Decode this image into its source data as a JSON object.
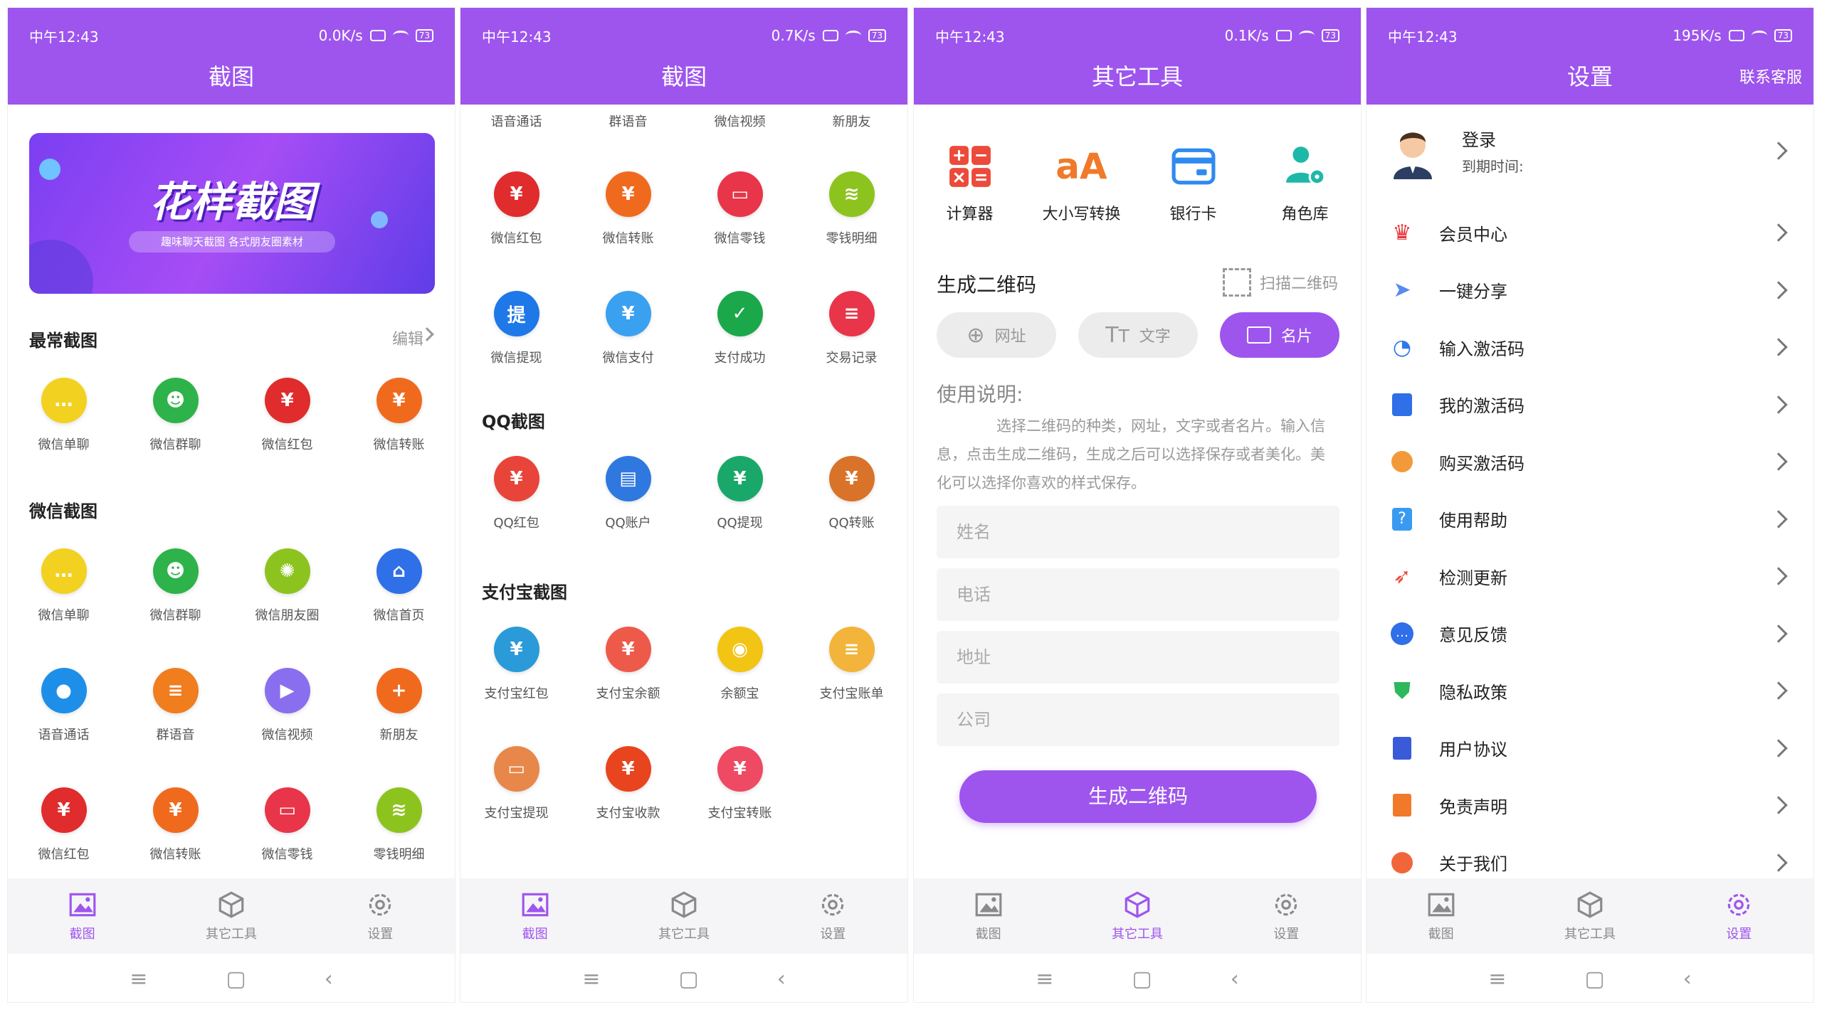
{
  "status": {
    "time": "中午12:43",
    "speeds": [
      "0.0K/s",
      "0.7K/s",
      "0.1K/s",
      "195K/s"
    ],
    "battery": "73"
  },
  "accent": "#9e55ee",
  "tabs": {
    "screenshot": "截图",
    "tools": "其它工具",
    "settings": "设置"
  },
  "panel1": {
    "title": "截图",
    "banner": {
      "title": "花样截图",
      "subtitle": "趣味聊天截图 各式朋友圈素材"
    },
    "frequent": {
      "title": "最常截图",
      "edit": "编辑",
      "items": [
        "微信单聊",
        "微信群聊",
        "微信红包",
        "微信转账"
      ]
    },
    "wechat": {
      "title": "微信截图",
      "items": [
        "微信单聊",
        "微信群聊",
        "微信朋友圈",
        "微信首页",
        "语音通话",
        "群语音",
        "微信视频",
        "新朋友",
        "微信红包",
        "微信转账",
        "微信零钱",
        "零钱明细"
      ]
    }
  },
  "panel2": {
    "title": "截图",
    "top_labels": [
      "语音通话",
      "群语音",
      "微信视频",
      "新朋友"
    ],
    "wechat_items": [
      "微信红包",
      "微信转账",
      "微信零钱",
      "零钱明细",
      "微信提现",
      "微信支付",
      "支付成功",
      "交易记录"
    ],
    "qq": {
      "title": "QQ截图",
      "items": [
        "QQ红包",
        "QQ账户",
        "QQ提现",
        "QQ转账"
      ]
    },
    "alipay": {
      "title": "支付宝截图",
      "items": [
        "支付宝红包",
        "支付宝余额",
        "余额宝",
        "支付宝账单",
        "支付宝提现",
        "支付宝收款",
        "支付宝转账"
      ]
    }
  },
  "panel3": {
    "title": "其它工具",
    "tools": [
      "计算器",
      "大小写转换",
      "银行卡",
      "角色库"
    ],
    "qr_title": "生成二维码",
    "scan": "扫描二维码",
    "chips": [
      "网址",
      "文字",
      "名片"
    ],
    "usage_title": "使用说明:",
    "usage_text": "选择二维码的种类，网址，文字或者名片。输入信息，点击生成二维码，生成之后可以选择保存或者美化。美化可以选择你喜欢的样式保存。",
    "fields": [
      "姓名",
      "电话",
      "地址",
      "公司"
    ],
    "generate": "生成二维码"
  },
  "panel4": {
    "title": "设置",
    "contact": "联系客服",
    "login": "登录",
    "expire": "到期时间:",
    "menu": [
      "会员中心",
      "一键分享",
      "输入激活码",
      "我的激活码",
      "购买激活码",
      "使用帮助",
      "检测更新",
      "意见反馈",
      "隐私政策",
      "用户协议",
      "免责声明",
      "关于我们"
    ]
  }
}
